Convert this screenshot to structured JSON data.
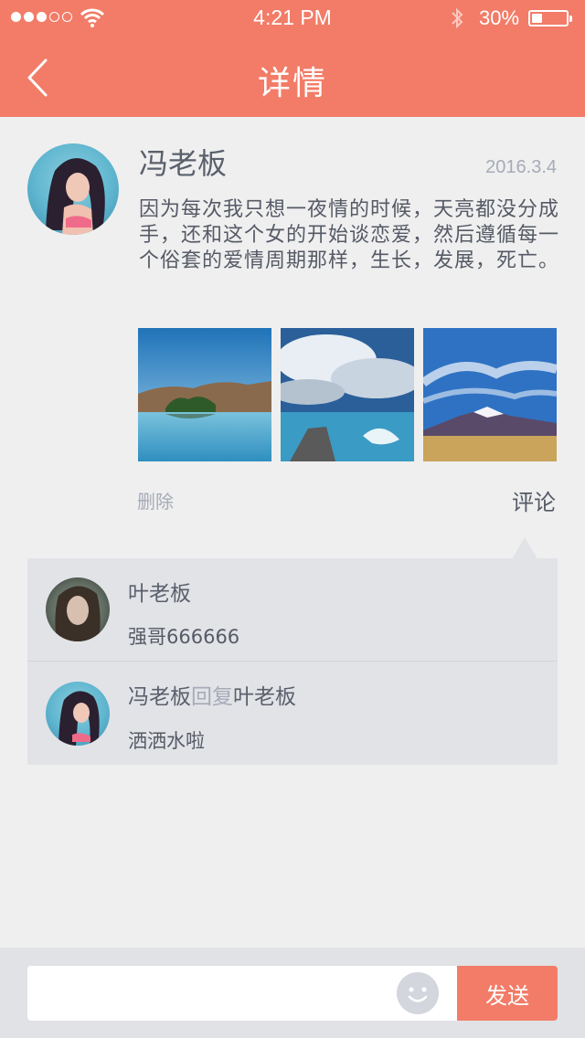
{
  "status_bar": {
    "time": "4:21 PM",
    "battery_percent": "30%",
    "battery_level": 0.3,
    "signal_bars_total": 5,
    "signal_bars_filled": 3
  },
  "nav": {
    "title": "详情",
    "back_icon": "chevron-left-icon"
  },
  "post": {
    "author": "冯老板",
    "date": "2016.3.4",
    "text": "因为每次我只想一夜情的时候，天亮都没分成手，还和这个女的开始谈恋爱，然后遵循每一个俗套的爱情周期那样，生长，发展，死亡。",
    "photos": [
      "lake-landscape",
      "stone-pier-clouds",
      "snow-mountain-field"
    ],
    "delete_label": "删除",
    "comment_label": "评论"
  },
  "comments": [
    {
      "author": "叶老板",
      "text": "强哥666666"
    },
    {
      "author": "冯老板",
      "reply_word": "回复",
      "reply_to": "叶老板",
      "text": "洒洒水啦"
    }
  ],
  "composer": {
    "placeholder": "",
    "emoji_icon": "smiley-icon",
    "send_label": "发送"
  },
  "colors": {
    "accent": "#f27c68",
    "background": "#efefef",
    "comment_bg": "#e2e3e7",
    "muted_text": "#a6abb8"
  }
}
